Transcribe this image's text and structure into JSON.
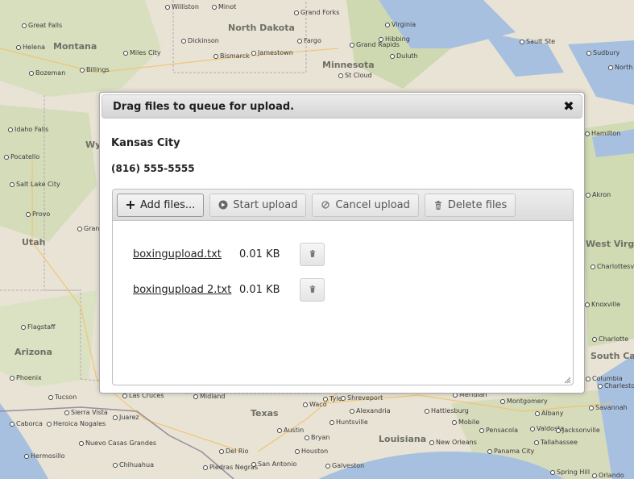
{
  "map": {
    "states": [
      "Montana",
      "North Dakota",
      "Minnesota",
      "Wyoming",
      "Utah",
      "Arizona",
      "Texas",
      "Louisiana",
      "West Virginia",
      "South Carolina"
    ],
    "cities": [
      "Williston",
      "Minot",
      "Grand Forks",
      "Virginia",
      "Great Falls",
      "Dickinson",
      "Bismarck",
      "Jamestown",
      "Fargo",
      "Grand Rapids",
      "Hibbing",
      "Duluth",
      "Sault Ste",
      "Sudbury",
      "Helena",
      "Miles City",
      "Bozeman",
      "Billings",
      "St Cloud",
      "North Bay",
      "Idaho Falls",
      "Pocatello",
      "Salt Lake City",
      "Provo",
      "Grand Junction",
      "Flagstaff",
      "Phoenix",
      "Tucson",
      "Las Cruces",
      "Midland",
      "Tyler",
      "Shreveport",
      "Meridian",
      "Montgomery",
      "Savannah",
      "Hamilton",
      "Akron",
      "Charlottesville",
      "Charlotte",
      "Sierra Vista",
      "Juarez",
      "Caborca",
      "Heroica Nogales",
      "Nuevo Casas Grandes",
      "Hermosillo",
      "Chihuahua",
      "Del Rio",
      "Piedras Negras",
      "San Antonio",
      "Austin",
      "Waco",
      "Huntsville",
      "Houston",
      "Bryan",
      "Galveston",
      "Alexandria",
      "Hattiesburg",
      "Mobile",
      "New Orleans",
      "Pensacola",
      "Valdosta",
      "Tallahassee",
      "Jacksonville",
      "Albany",
      "Panama City",
      "Spring Hill",
      "Orlando",
      "Knoxville",
      "Columbia",
      "Charleston"
    ]
  },
  "dialog": {
    "title": "Drag files to queue for upload.",
    "close_symbol": "✖",
    "name": "Kansas City",
    "phone": "(816) 555-5555",
    "toolbar": {
      "add_label": "Add files...",
      "start_label": "Start upload",
      "cancel_label": "Cancel upload",
      "delete_label": "Delete files"
    },
    "files": [
      {
        "name": "boxingupload.txt",
        "size": "0.01 KB"
      },
      {
        "name": "boxingupload 2.txt",
        "size": "0.01 KB"
      }
    ]
  },
  "colors": {
    "map_land": "#e8e3d4",
    "map_green": "#cdd9b0",
    "map_water": "#a7c0e0"
  }
}
